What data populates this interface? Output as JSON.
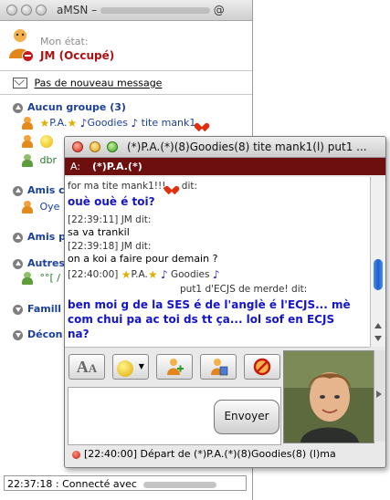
{
  "main_window": {
    "title": "aMSN –",
    "title_suffix": "@",
    "status_label": "Mon état:",
    "status_value": "JM (Occupé)",
    "mail_link": "Pas de nouveau message",
    "groups": [
      {
        "label": "Aucun groupe (3)",
        "expanded": true
      },
      {
        "label": "Amis co",
        "expanded": true
      },
      {
        "label": "Amis p",
        "expanded": true
      },
      {
        "label": "Autres",
        "expanded": true
      },
      {
        "label": "Famill",
        "expanded": false
      },
      {
        "label": "Décon",
        "expanded": false
      }
    ],
    "contacts": [
      {
        "name": "P.A.",
        "extra": "Goodies",
        "extra2": "tite mank1"
      },
      {
        "name": "dbr"
      },
      {
        "name": "Oye"
      },
      {
        "name": "°°[ /"
      }
    ],
    "statusbar": "22:37:18 : Connecté avec"
  },
  "chat_window": {
    "title": "(*)P.A.(*)(8)Goodies(8) tite mank1(l) put1 ...",
    "to_label": "A:",
    "to_name": "(*)P.A.(*)",
    "messages": [
      {
        "meta": "for ma tite mank1!!!",
        "meta_suffix": "dit:",
        "text": "ouè ouè é toi?",
        "bold": true
      },
      {
        "meta": "[22:39:11] JM dit:",
        "text": "sa va trankil"
      },
      {
        "meta": "[22:39:18] JM dit:",
        "text": "on a koi a faire pour demain ?"
      },
      {
        "meta": "[22:40:00]",
        "meta_extra": "P.A.",
        "meta_goodies": "Goodies"
      },
      {
        "meta": "put1 d'ECJS de merde! dit:",
        "text": "ben moi g de la SES é de l'anglè é l'ECJS... mè com chui pa ac toi ds tt ça... lol sof en ECJS na?",
        "bold": true
      }
    ],
    "message_lines": [
      "ben moi g de la SES é de l'anglè é l'ECJS... mè",
      "com chui pa ac toi ds tt ça... lol sof en ECJS",
      "na?"
    ],
    "toolbar_buttons": [
      "font-icon",
      "smiley-icon",
      "add-contact-icon",
      "send-file-icon",
      "block-icon"
    ],
    "send_button": "Envoyer",
    "status_line": "[22:40:00] Départ de (*)P.A.(*)(8)Goodies(8) (l)ma"
  },
  "colors": {
    "status_busy": "#b01010",
    "group_blue": "#1b3f9c",
    "to_bar": "#6e0f0f",
    "bold_message": "#1414c8"
  }
}
